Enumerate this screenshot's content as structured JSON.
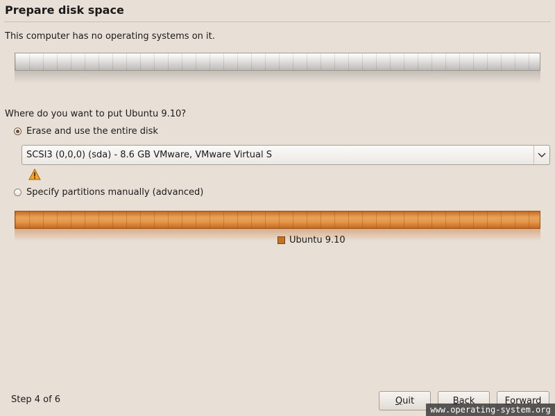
{
  "page": {
    "title": "Prepare disk space",
    "intro": "This computer has no operating systems on it.",
    "question": "Where do you want to put Ubuntu 9.10?"
  },
  "options": {
    "erase": {
      "label": "Erase and use the entire disk",
      "selected": true
    },
    "manual": {
      "label": "Specify partitions manually (advanced)",
      "selected": false
    }
  },
  "disk_select": {
    "value": "SCSI3 (0,0,0) (sda) - 8.6 GB VMware, VMware Virtual S"
  },
  "legend": {
    "label": "Ubuntu 9.10",
    "color": "#c8711f"
  },
  "footer": {
    "step": "Step 4 of 6",
    "quit_mnemonic": "Q",
    "quit_rest": "uit",
    "back_mnemonic": "B",
    "back_rest": "ack",
    "forward_mnemonic": "F",
    "forward_rest": "orward"
  },
  "watermark": "www.operating-system.org",
  "icons": {
    "warning": "warning-triangle-icon",
    "dropdown": "chevron-down-icon"
  }
}
